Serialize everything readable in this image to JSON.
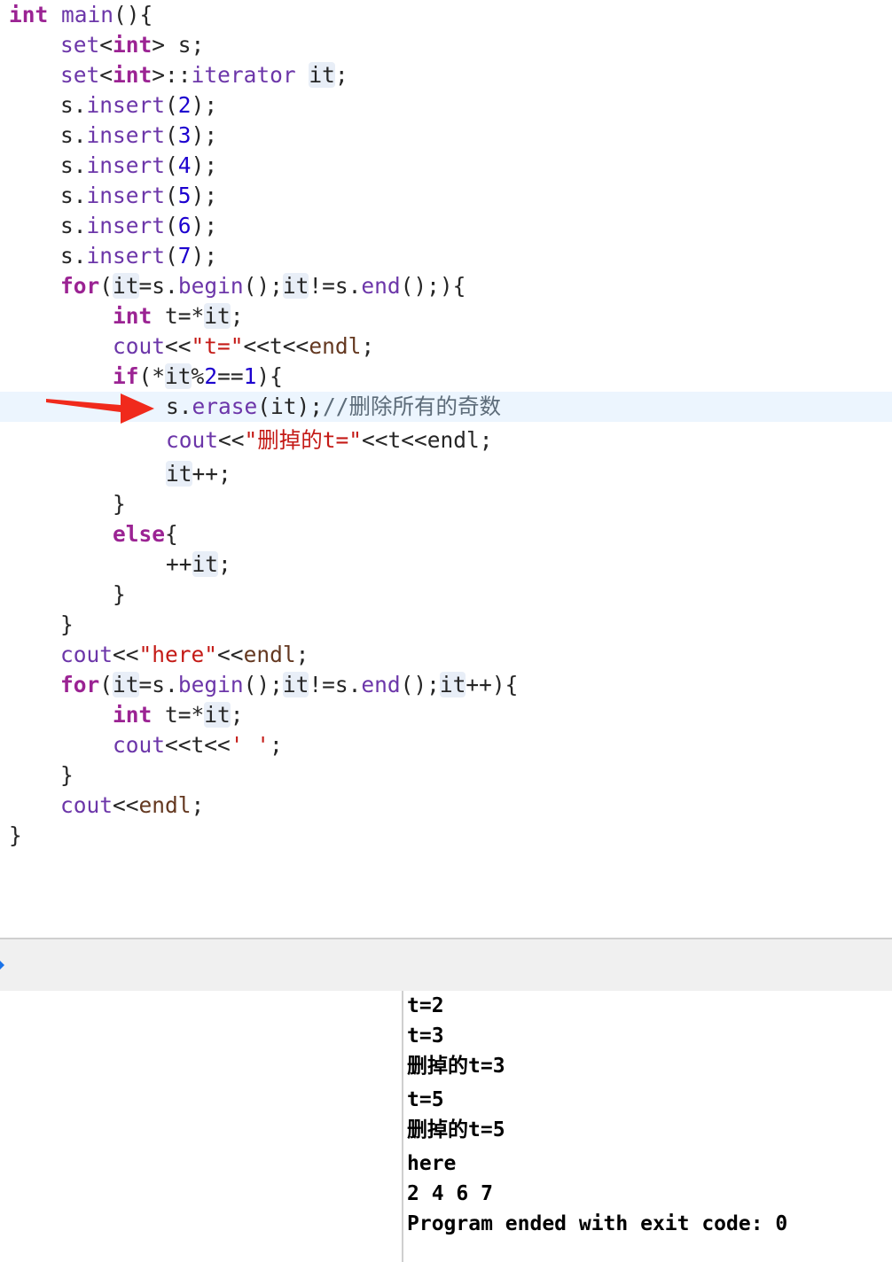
{
  "code": {
    "l1": [
      "int",
      " ",
      "main",
      "(){"
    ],
    "l2": [
      "set",
      "<",
      "int",
      "> s;"
    ],
    "l3": [
      "set",
      "<",
      "int",
      ">::",
      "iterator",
      " ",
      "it",
      ";"
    ],
    "l4": [
      "s.",
      "insert",
      "(",
      "2",
      ");"
    ],
    "l5": [
      "s.",
      "insert",
      "(",
      "3",
      ");"
    ],
    "l6": [
      "s.",
      "insert",
      "(",
      "4",
      ");"
    ],
    "l7": [
      "s.",
      "insert",
      "(",
      "5",
      ");"
    ],
    "l8": [
      "s.",
      "insert",
      "(",
      "6",
      ");"
    ],
    "l9": [
      "s.",
      "insert",
      "(",
      "7",
      ");"
    ],
    "l10": [
      "for",
      "(",
      "it",
      "=s.",
      "begin",
      "();",
      "it",
      "!=s.",
      "end",
      "();){"
    ],
    "l11": [
      "int",
      " t=*",
      "it",
      ";"
    ],
    "l12": [
      "cout",
      "<<",
      "\"t=\"",
      "<<t<<",
      "endl",
      ";"
    ],
    "l13": [
      "if",
      "(*",
      "it",
      "%",
      "2",
      "==",
      "1",
      "){"
    ],
    "l14": [
      "s.",
      "erase",
      "(it);",
      "//删除所有的奇数"
    ],
    "l15": [
      "cout",
      "<<",
      "\"删掉的t=\"",
      "<<t<<endl;"
    ],
    "l16": [
      "it",
      "++;"
    ],
    "l17": [
      "}"
    ],
    "l18": [
      "else",
      "{"
    ],
    "l19": [
      "++",
      "it",
      ";"
    ],
    "l20": [
      "}"
    ],
    "l21": [
      "}"
    ],
    "l22": [
      "cout",
      "<<",
      "\"here\"",
      "<<",
      "endl",
      ";"
    ],
    "l23": [
      "for",
      "(",
      "it",
      "=s.",
      "begin",
      "();",
      "it",
      "!=s.",
      "end",
      "();",
      "it",
      "++){"
    ],
    "l24": [
      "int",
      " t=*",
      "it",
      ";"
    ],
    "l25": [
      "cout",
      "<<t<<",
      "' '",
      ";"
    ],
    "l26": [
      "}"
    ],
    "l27": [
      "cout",
      "<<",
      "endl",
      ";"
    ],
    "l28": [
      "}"
    ]
  },
  "console": {
    "lines": [
      "t=2",
      "t=3",
      "删掉的t=3",
      "t=5",
      "删掉的t=5",
      "here",
      "2 4 6 7",
      "Program ended with exit code: 0"
    ]
  },
  "colors": {
    "keyword": "#9b2393",
    "function": "#6c36a9",
    "number": "#1c00cf",
    "string": "#c41a16",
    "comment": "#5d6c79",
    "class": "#643820",
    "highlight_line": "#ecf5fe",
    "arrow": "#f02a1c"
  },
  "icons": {
    "arrow": "red-arrow-icon",
    "debug": "debug-indicator-icon"
  }
}
